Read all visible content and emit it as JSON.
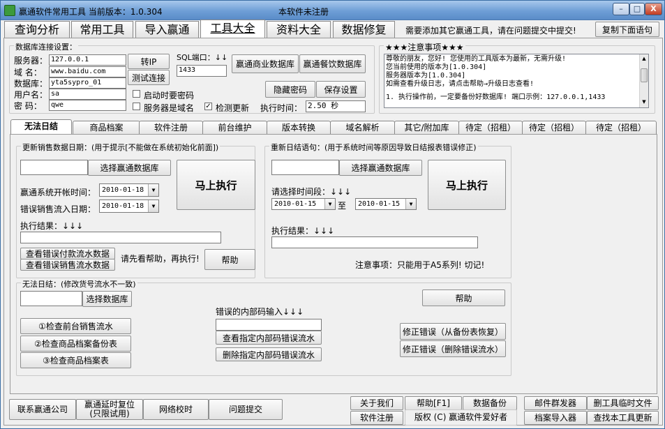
{
  "window": {
    "title": "赢通软件常用工具  当前版本：1.0.304",
    "center_text": "本软件未注册",
    "min_label": "–",
    "max_label": "□",
    "close_label": "X"
  },
  "main_tabs": [
    {
      "label": "查询分析"
    },
    {
      "label": "常用工具"
    },
    {
      "label": "导入赢通"
    },
    {
      "label": "工具大全"
    },
    {
      "label": "资料大全"
    },
    {
      "label": "数据修复"
    }
  ],
  "header_hint": "需要添加其它赢通工具，请在问题提交中提交!",
  "copy_button": "复制下面语句",
  "db": {
    "legend": "数据库连接设置：",
    "server_label": "服务器：",
    "server_value": "127.0.0.1",
    "domain_label": "域   名：",
    "domain_value": "www.baidu.com",
    "database_label": "数据库：",
    "database_value": "yta5sypro_01",
    "user_label": "用户名：",
    "user_value": "sa",
    "password_label": "密   码：",
    "password_value": "qwe",
    "to_ip": "转IP",
    "test_conn": "测试连接",
    "sql_port_label": "SQL端口：↓↓",
    "sql_port_value": "1433",
    "commercial_db": "赢通商业数据库",
    "catering_db": "赢通餐饮数据库",
    "hide_password": "隐藏密码",
    "save_settings": "保存设置",
    "cb_startup_password": "启动时要密码",
    "cb_server_domain": "服务器是域名",
    "cb_check_update": "检测更新",
    "cb_check_update_checked": "✓",
    "exec_time_label": "执行时间：",
    "exec_time_value": "2.50 秒"
  },
  "notice": {
    "legend": "★★★注意事项★★★",
    "lines": [
      "尊敬的朋友，您好! 您使用的工具版本为最新，无需升级!",
      "您当前使用的版本为[1.0.304]",
      "服务器版本为[1.0.304]",
      "如需查看升级日志，请点击帮助→升级日志查看!",
      "",
      "1. 执行操作前，一定要备份好数据库! 端口示例：127.0.0.1,1433"
    ]
  },
  "content_tabs": [
    {
      "label": "无法日结"
    },
    {
      "label": "商品档案"
    },
    {
      "label": "软件注册"
    },
    {
      "label": "前台维护"
    },
    {
      "label": "版本转换"
    },
    {
      "label": "域名解析"
    },
    {
      "label": "其它/附加库"
    },
    {
      "label": "待定（招租）"
    },
    {
      "label": "待定（招租）"
    },
    {
      "label": "待定（招租）"
    }
  ],
  "update_sales": {
    "legend": "更新销售数据日期：(用于提示[不能做在系统初始化前面])",
    "select_db": "选择赢通数据库",
    "execute": "马上执行",
    "open_time_label": "赢通系统开帐时间：",
    "open_time_value": "2010-01-18",
    "wrong_date_label": "错误销售流入日期：",
    "wrong_date_value": "2010-01-18",
    "result_label": "执行结果：↓↓↓",
    "view_pay_flow": "查看错误付款流水数据",
    "view_sales_flow": "查看错误销售流水数据",
    "help_hint": "请先看帮助，再执行!",
    "help": "帮助"
  },
  "re_daily": {
    "legend": "重新日结语句：(用于系统时间等原因导致日结报表错误修正)",
    "select_db": "选择赢通数据库",
    "execute": "马上执行",
    "period_label": "请选择时间段：↓↓↓",
    "from_value": "2010-01-15",
    "to_label": "至",
    "to_value": "2010-01-15",
    "result_label": "执行结果：↓↓↓",
    "note": "注意事项：只能用于A5系列! 切记!"
  },
  "no_daily": {
    "legend": "无法日结：(修改货号流水不一致)",
    "select_db": "选择数据库",
    "check_front_sales": "①检查前台销售流水",
    "check_backup": "②检查商品档案备份表",
    "check_goods": "③检查商品档案表",
    "wrong_code_label": "错误的内部码输入↓↓↓",
    "view_wrong_flow": "查看指定内部码错误流水",
    "delete_wrong_flow": "删除指定内部码错误流水",
    "help": "帮助",
    "fix_restore": "修正错误（从备份表恢复）",
    "fix_delete": "修正错误（删除错误流水）"
  },
  "bottom": {
    "contact": "联系赢通公司",
    "delay_reset_line1": "赢通延时复位",
    "delay_reset_line2": "(只限试用)",
    "time_sync": "网络校时",
    "submit_issue": "问题提交",
    "about": "关于我们",
    "help_f1": "帮助[F1]",
    "backup": "数据备份",
    "register": "软件注册",
    "copyright": "版权 (C) 赢通软件爱好者",
    "mail_sender": "邮件群发器",
    "delete_temp": "删工具临时文件",
    "file_import": "档案导入器",
    "update_check": "查找本工具更新"
  }
}
